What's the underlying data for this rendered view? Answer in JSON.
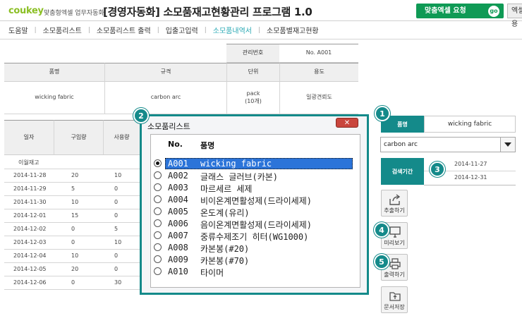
{
  "header": {
    "logo": "coukey",
    "logo_sub": "맞춤형엑셀 업무자동화",
    "app_title": "[경영자동화] 소모품재고현황관리 프로그램 1.0",
    "request_button": "맞춤엑셀 요청",
    "go_badge": "go",
    "excel_button": "엑셀사용"
  },
  "menu": {
    "items": [
      "도움말",
      "소모품리스트",
      "소모품리스트 출력",
      "입출고입력",
      "소모품내역서",
      "소모품별재고현황"
    ],
    "active_index": 4
  },
  "info_table": {
    "mgmt_label": "관리번호",
    "mgmt_value": "No. A001",
    "headers": [
      "품명",
      "규격",
      "단위",
      "용도"
    ],
    "values": [
      "wicking fabric",
      "carbon arc",
      "pack\n(10개)",
      "일광견뢰도"
    ]
  },
  "list_table": {
    "headers": [
      "일자",
      "구입량",
      "사용량"
    ],
    "rows": [
      [
        "이월재고",
        "",
        ""
      ],
      [
        "2014-11-28",
        "20",
        "10"
      ],
      [
        "2014-11-29",
        "5",
        "0"
      ],
      [
        "2014-11-30",
        "10",
        "0"
      ],
      [
        "2014-12-01",
        "15",
        "0"
      ],
      [
        "2014-12-02",
        "0",
        "5"
      ],
      [
        "2014-12-03",
        "0",
        "10"
      ],
      [
        "2014-12-04",
        "10",
        "0"
      ],
      [
        "2014-12-05",
        "20",
        "0"
      ],
      [
        "2014-12-06",
        "0",
        "30"
      ]
    ]
  },
  "badges": [
    "1",
    "2",
    "3",
    "4",
    "5"
  ],
  "right_panel": {
    "item_label": "품명",
    "item_value": "wicking fabric",
    "spec_select": "carbon arc",
    "period_label": "검색기간",
    "date_from": "2014-11-27",
    "date_to": "2014-12-31",
    "buttons": [
      "추출하기",
      "미리보기",
      "출력하기",
      "문서저장"
    ]
  },
  "dialog": {
    "title": "소모품리스트",
    "close": "✕",
    "col_no": "No.",
    "col_name": "품명",
    "selected_index": 0,
    "items": [
      {
        "no": "A001",
        "name": "wicking fabric"
      },
      {
        "no": "A002",
        "name": "글래스 글러브(카본)"
      },
      {
        "no": "A003",
        "name": "마르세르 세제"
      },
      {
        "no": "A004",
        "name": "비이온계면활성제(드라이세제)"
      },
      {
        "no": "A005",
        "name": "온도계(유리)"
      },
      {
        "no": "A006",
        "name": "음이온계면활성제(드라이세제)"
      },
      {
        "no": "A007",
        "name": "중류수제조기 히터(WG1000)"
      },
      {
        "no": "A008",
        "name": "카본봉(#20)"
      },
      {
        "no": "A009",
        "name": "카본봉(#70)"
      },
      {
        "no": "A010",
        "name": "타이머"
      }
    ]
  },
  "colors": {
    "accent": "#148a8a",
    "brand_green": "#0f9a55",
    "selection": "#2b74d9"
  }
}
